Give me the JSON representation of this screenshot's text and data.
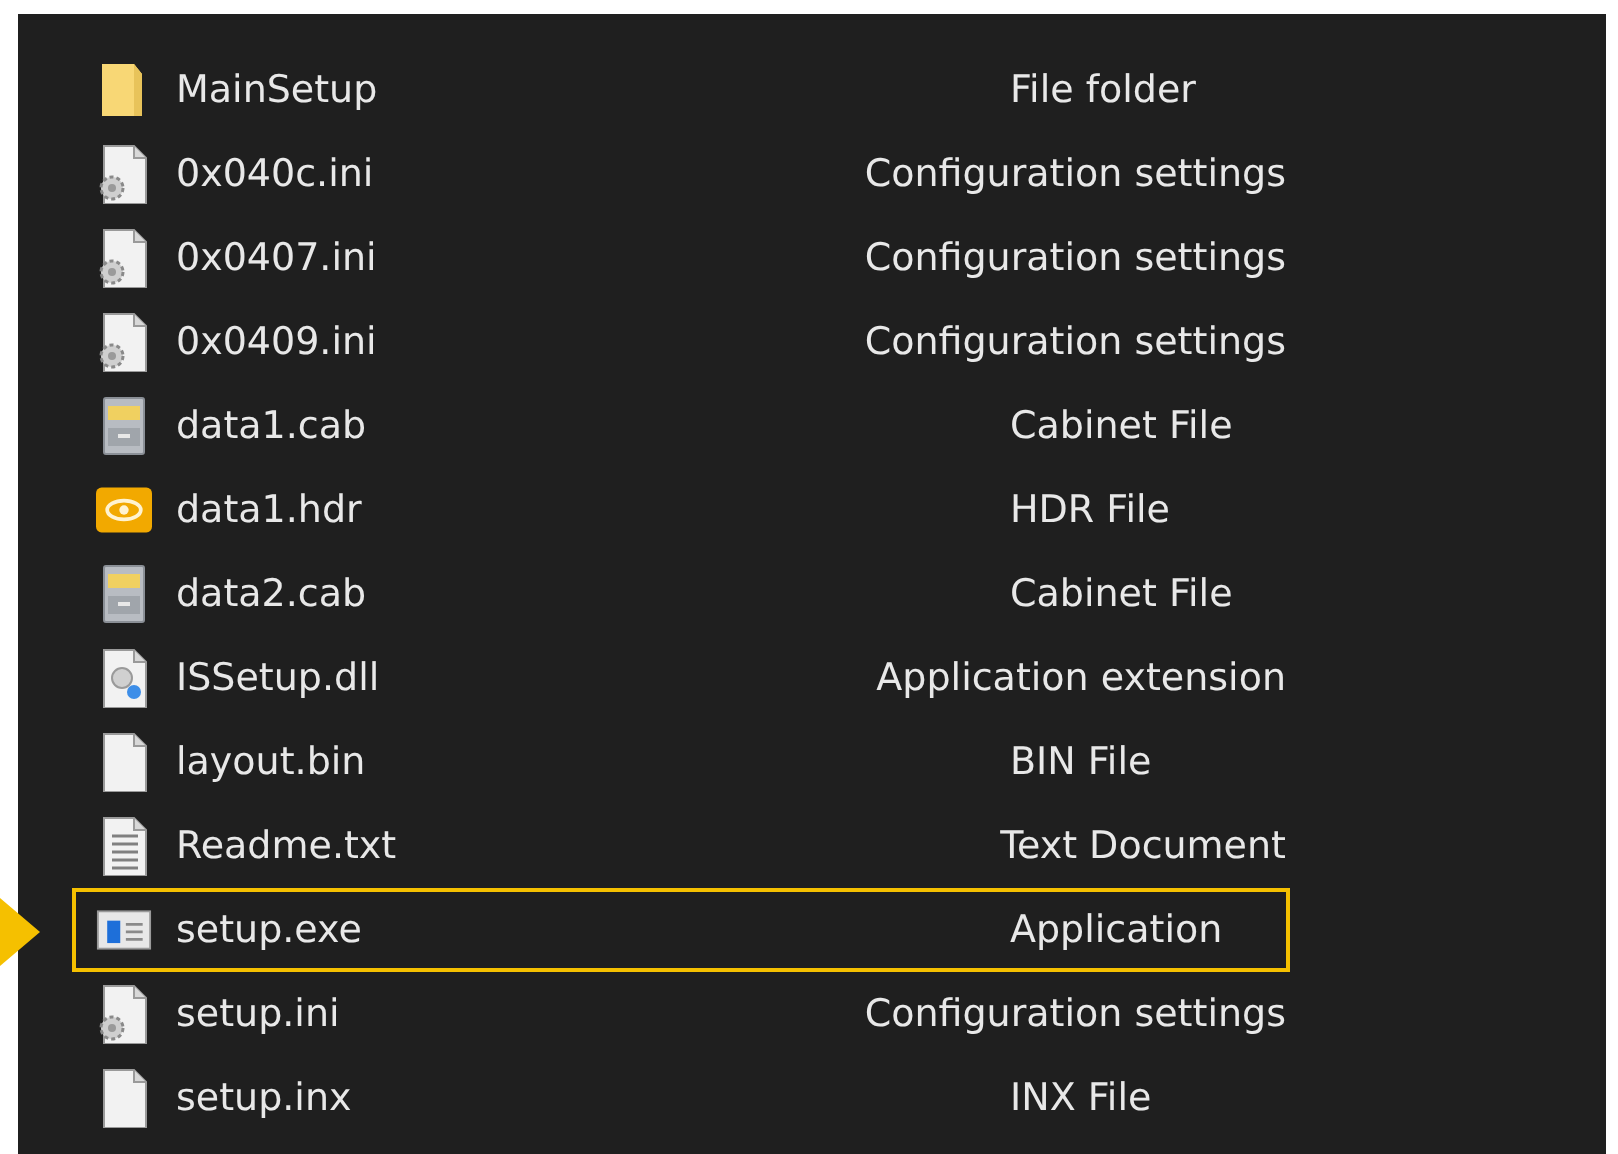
{
  "files": [
    {
      "name": "MainSetup",
      "type": "File folder",
      "kind": "folder",
      "selected": false
    },
    {
      "name": "0x040c.ini",
      "type": "Configuration settings",
      "kind": "ini",
      "selected": false
    },
    {
      "name": "0x0407.ini",
      "type": "Configuration settings",
      "kind": "ini",
      "selected": false
    },
    {
      "name": "0x0409.ini",
      "type": "Configuration settings",
      "kind": "ini",
      "selected": false
    },
    {
      "name": "data1.cab",
      "type": "Cabinet File",
      "kind": "cab",
      "selected": false
    },
    {
      "name": "data1.hdr",
      "type": "HDR File",
      "kind": "hdr",
      "selected": false
    },
    {
      "name": "data2.cab",
      "type": "Cabinet File",
      "kind": "cab",
      "selected": false
    },
    {
      "name": "ISSetup.dll",
      "type": "Application extension",
      "kind": "dll",
      "selected": false
    },
    {
      "name": "layout.bin",
      "type": "BIN File",
      "kind": "blank",
      "selected": false
    },
    {
      "name": "Readme.txt",
      "type": "Text Document",
      "kind": "txt",
      "selected": false
    },
    {
      "name": "setup.exe",
      "type": "Application",
      "kind": "exe",
      "selected": true
    },
    {
      "name": "setup.ini",
      "type": "Configuration settings",
      "kind": "ini",
      "selected": false
    },
    {
      "name": "setup.inx",
      "type": "INX File",
      "kind": "blank",
      "selected": false
    }
  ]
}
